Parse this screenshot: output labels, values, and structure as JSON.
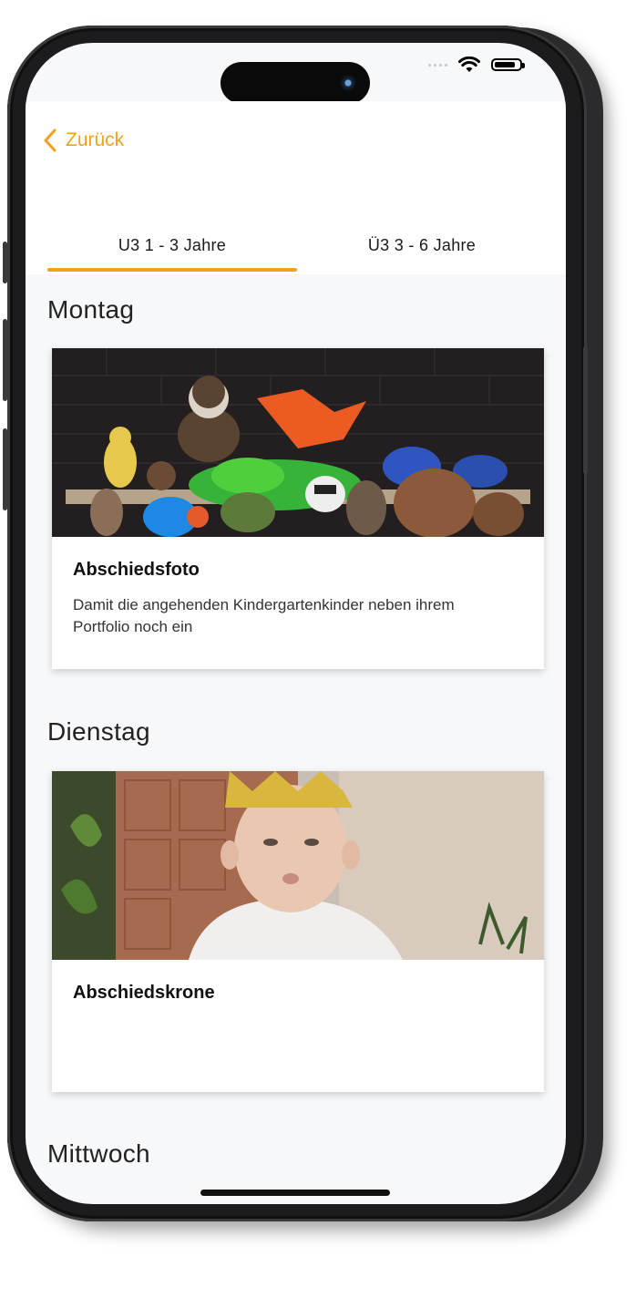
{
  "nav": {
    "back_label": "Zurück"
  },
  "tabs": [
    {
      "label": "U3 1 - 3 Jahre",
      "selected": true
    },
    {
      "label": "Ü3 3 - 6 Jahre",
      "selected": false
    }
  ],
  "days": [
    {
      "day": "Montag",
      "card": {
        "title": "Abschiedsfoto",
        "text": "Damit die angehenden Kindergartenkinder neben ihrem Portfolio noch ein"
      }
    },
    {
      "day": "Dienstag",
      "card": {
        "title": "Abschiedskrone",
        "text": ""
      }
    },
    {
      "day": "Mittwoch"
    }
  ],
  "colors": {
    "accent": "#f2a21a",
    "background": "#f7f8fa",
    "card": "#ffffff"
  },
  "icons": {
    "back": "chevron-left-icon",
    "wifi": "wifi-icon",
    "battery": "battery-icon"
  }
}
